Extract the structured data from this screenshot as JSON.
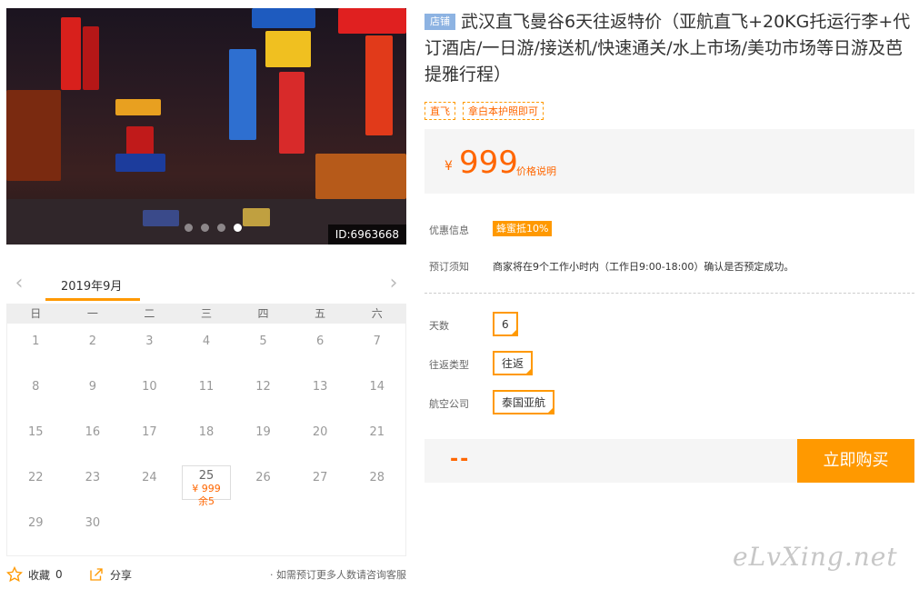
{
  "hero": {
    "id_label": "ID:6963668"
  },
  "calendar": {
    "month": "2019年9月",
    "weekdays": [
      "日",
      "一",
      "二",
      "三",
      "四",
      "五",
      "六"
    ],
    "days": [
      "1",
      "2",
      "3",
      "4",
      "5",
      "6",
      "7",
      "8",
      "9",
      "10",
      "11",
      "12",
      "13",
      "14",
      "15",
      "16",
      "17",
      "18",
      "19",
      "20",
      "21",
      "22",
      "23",
      "24",
      "25",
      "26",
      "27",
      "28",
      "29",
      "30"
    ],
    "active_day": {
      "day": "25",
      "price": "¥ 999",
      "stock": "余5"
    }
  },
  "footer": {
    "fav_label": "收藏",
    "fav_count": "0",
    "share_label": "分享",
    "hint": "· 如需预订更多人数请咨询客服"
  },
  "product": {
    "shop_badge": "店铺",
    "title": "武汉直飞曼谷6天往返特价（亚航直飞+20KG托运行李+代订酒店/一日游/接送机/快速通关/水上市场/美功市场等日游及芭提雅行程）",
    "tags": [
      "直飞",
      "拿白本护照即可"
    ]
  },
  "price": {
    "currency": "¥",
    "value": "999",
    "note": "价格说明"
  },
  "info": {
    "promo_label": "优惠信息",
    "promo_value": "蜂蜜抵10%",
    "booking_label": "预订须知",
    "booking_value": "商家将在9个工作小时内（工作日9:00-18:00）确认是否预定成功。"
  },
  "options": {
    "days_label": "天数",
    "days_value": "6",
    "trip_label": "往返类型",
    "trip_value": "往返",
    "airline_label": "航空公司",
    "airline_value": "泰国亚航"
  },
  "buy": {
    "total": "--",
    "button": "立即购买"
  },
  "watermark": "eLvXing.net",
  "colors": {
    "accent": "#ff9900",
    "price": "#ff6600",
    "shop_badge": "#8db3e2"
  }
}
